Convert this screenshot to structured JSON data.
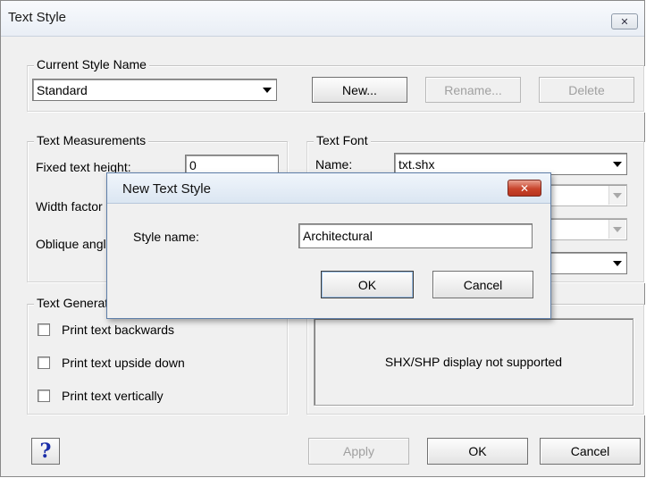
{
  "window": {
    "title": "Text Style",
    "close_glyph": "✕"
  },
  "current_style": {
    "legend": "Current Style Name",
    "selected": "Standard",
    "new_label": "New...",
    "rename_label": "Rename...",
    "delete_label": "Delete"
  },
  "measurements": {
    "legend": "Text Measurements",
    "fixed_height_label": "Fixed text height:",
    "fixed_height_value": "0",
    "width_factor_label": "Width factor",
    "oblique_angle_label": "Oblique angle"
  },
  "font": {
    "legend": "Text Font",
    "name_label": "Name:",
    "name_value": "txt.shx"
  },
  "generation": {
    "legend": "Text Generation",
    "options": [
      {
        "label": "Print text backwards",
        "checked": false
      },
      {
        "label": "Print text upside down",
        "checked": false
      },
      {
        "label": "Print text vertically",
        "checked": false
      }
    ]
  },
  "preview": {
    "message": "SHX/SHP display not supported"
  },
  "footer": {
    "help_glyph": "?",
    "apply_label": "Apply",
    "ok_label": "OK",
    "cancel_label": "Cancel"
  },
  "modal": {
    "title": "New Text Style",
    "close_glyph": "✕",
    "style_name_label": "Style name:",
    "style_name_value": "Architectural",
    "ok_label": "OK",
    "cancel_label": "Cancel"
  },
  "icons": {
    "dialog_close": "close-icon",
    "modal_close": "close-icon",
    "dropdown": "chevron-down-icon",
    "help": "question-icon"
  }
}
